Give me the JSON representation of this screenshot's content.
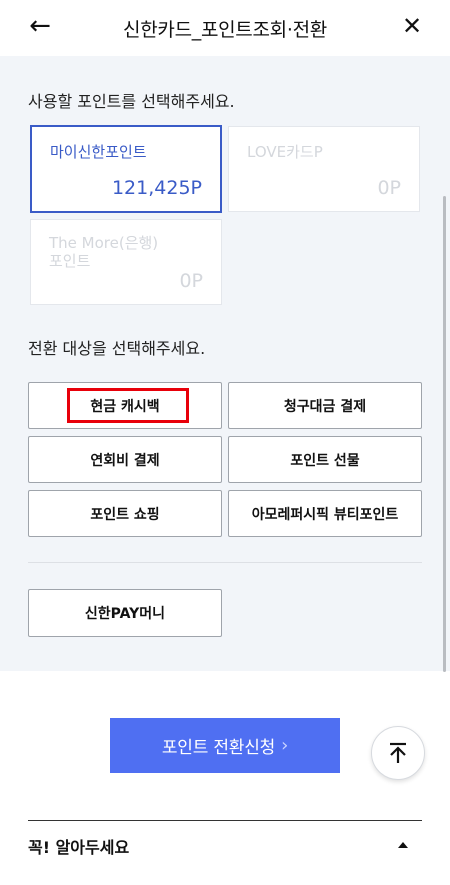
{
  "header": {
    "title": "신한카드_포인트조회·전환",
    "back_icon": "←",
    "close_icon": "✕"
  },
  "point_section": {
    "label": "사용할 포인트를 선택해주세요.",
    "cards": [
      {
        "name": "마이신한포인트",
        "value": "121,425P",
        "selected": true
      },
      {
        "name": "LOVE카드P",
        "value": "0P",
        "selected": false
      },
      {
        "name": "The More(은행)\n포인트",
        "value": "0P",
        "selected": false
      }
    ]
  },
  "target_section": {
    "label": "전환 대상을 선택해주세요.",
    "options": [
      "현금 캐시백",
      "청구대금 결제",
      "연회비 결제",
      "포인트 선물",
      "포인트 쇼핑",
      "아모레퍼시픽 뷰티포인트",
      "신한PAY머니"
    ]
  },
  "apply_button": {
    "label": "포인트 전환신청",
    "chevron": "›"
  },
  "notice": {
    "label": "꼭! 알아두세요"
  },
  "colors": {
    "accent": "#3a5bc7",
    "button": "#4f6ff2",
    "highlight": "#e8000a",
    "panel_bg": "#f2f5f9"
  }
}
